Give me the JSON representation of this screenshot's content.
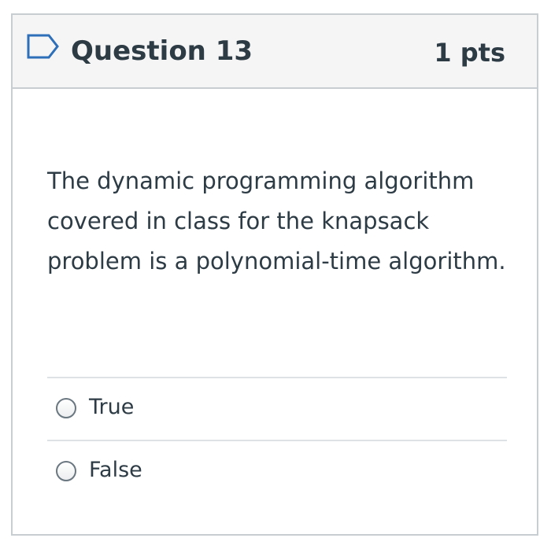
{
  "question": {
    "title": "Question 13",
    "points": "1 pts",
    "flag_icon": "flag-outline-icon",
    "text": "The dynamic programming algorithm covered in class for the knapsack problem is a polynomial-time algorithm."
  },
  "answers": [
    {
      "label": "True",
      "selected": false
    },
    {
      "label": "False",
      "selected": false
    }
  ],
  "colors": {
    "header_bg": "#f5f5f5",
    "border": "#c7cdd1",
    "text": "#2d3b45",
    "flag": "#2d6fb8"
  }
}
